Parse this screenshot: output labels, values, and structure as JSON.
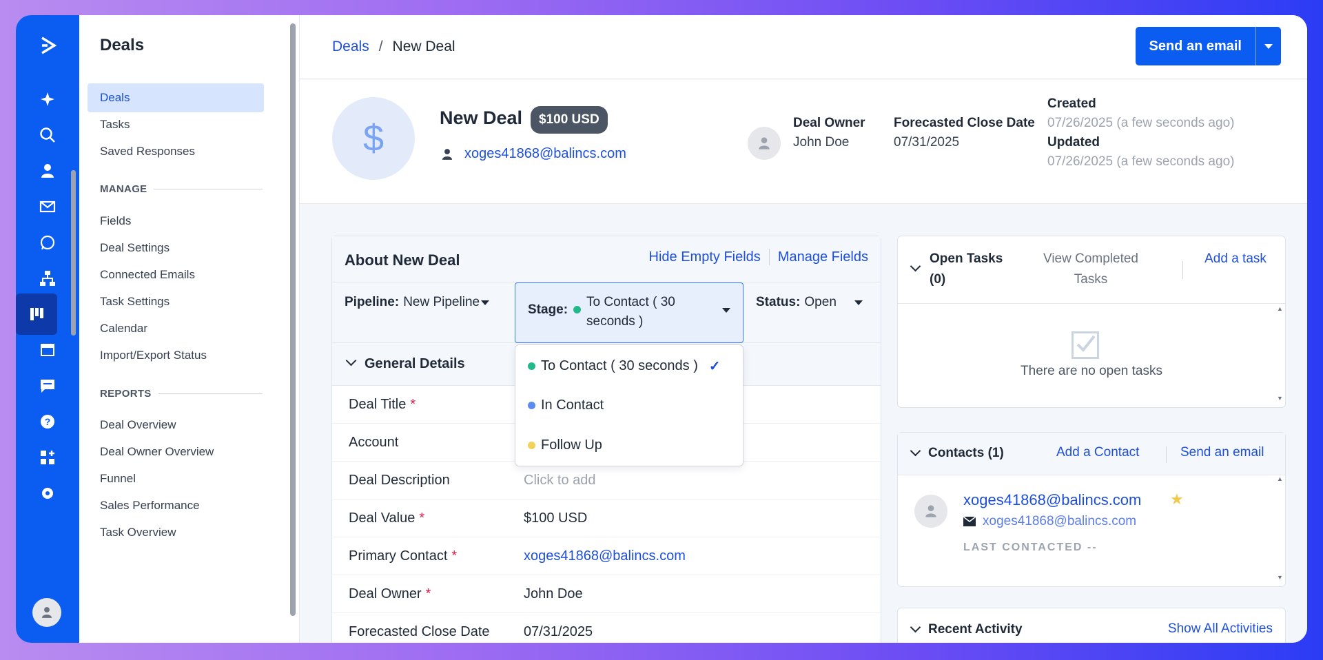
{
  "breadcrumb": {
    "root": "Deals",
    "separator": "/",
    "current": "New Deal"
  },
  "header_button": {
    "label": "Send an email"
  },
  "nav": {
    "title": "Deals",
    "items": [
      "Deals",
      "Tasks",
      "Saved Responses"
    ],
    "manage_label": "MANAGE",
    "manage_items": [
      "Fields",
      "Deal Settings",
      "Connected Emails",
      "Task Settings",
      "Calendar",
      "Import/Export Status"
    ],
    "reports_label": "REPORTS",
    "reports_items": [
      "Deal Overview",
      "Deal Owner Overview",
      "Funnel",
      "Sales Performance",
      "Task Overview"
    ]
  },
  "deal": {
    "avatar_symbol": "$",
    "name": "New Deal",
    "value_badge": "$100 USD",
    "contact_email": "xoges41868@balincs.com",
    "owner_label": "Deal Owner",
    "owner": "John Doe",
    "close_label": "Forecasted Close Date",
    "close_date": "07/31/2025",
    "created_label": "Created",
    "created": "07/26/2025 (a few seconds ago)",
    "updated_label": "Updated",
    "updated": "07/26/2025 (a few seconds ago)"
  },
  "about": {
    "title": "About New Deal",
    "hide_empty": "Hide Empty Fields",
    "manage_fields": "Manage Fields",
    "pipeline_label": "Pipeline:",
    "pipeline_value": "New Pipeline",
    "stage_label": "Stage:",
    "stage_value": "To Contact ( 30 seconds )",
    "status_label": "Status:",
    "status_value": "Open",
    "general_details": "General Details",
    "fields": [
      {
        "label": "Deal Title",
        "required": "*",
        "value": ""
      },
      {
        "label": "Account",
        "required": "",
        "value": ""
      },
      {
        "label": "Deal Description",
        "required": "",
        "value": "Click to add"
      },
      {
        "label": "Deal Value",
        "required": "*",
        "value": "$100 USD"
      },
      {
        "label": "Primary Contact",
        "required": "*",
        "value": "xoges41868@balincs.com"
      },
      {
        "label": "Deal Owner",
        "required": "*",
        "value": "John Doe"
      },
      {
        "label": "Forecasted Close Date",
        "required": "",
        "value": "07/31/2025"
      }
    ]
  },
  "stage_dropdown": {
    "options": [
      {
        "label": "To Contact ( 30 seconds )",
        "color": "#21b98a",
        "selected": true
      },
      {
        "label": "In Contact",
        "color": "#5b8def",
        "selected": false
      },
      {
        "label": "Follow Up",
        "color": "#f2d25c",
        "selected": false
      }
    ]
  },
  "tasks": {
    "title": "Open Tasks (0)",
    "view_completed": "View Completed Tasks",
    "add": "Add a task",
    "empty": "There are no open tasks"
  },
  "contacts": {
    "title": "Contacts (1)",
    "add": "Add a Contact",
    "send": "Send an email",
    "name": "xoges41868@balincs.com",
    "email": "xoges41868@balincs.com",
    "last_contacted": "LAST CONTACTED --"
  },
  "recent": {
    "title": "Recent Activity",
    "show_all": "Show All Activities"
  },
  "colors": {
    "accent": "#0b5cf0",
    "link": "#1d4fd8",
    "required": "#e11d48",
    "star": "#f2c94c"
  }
}
